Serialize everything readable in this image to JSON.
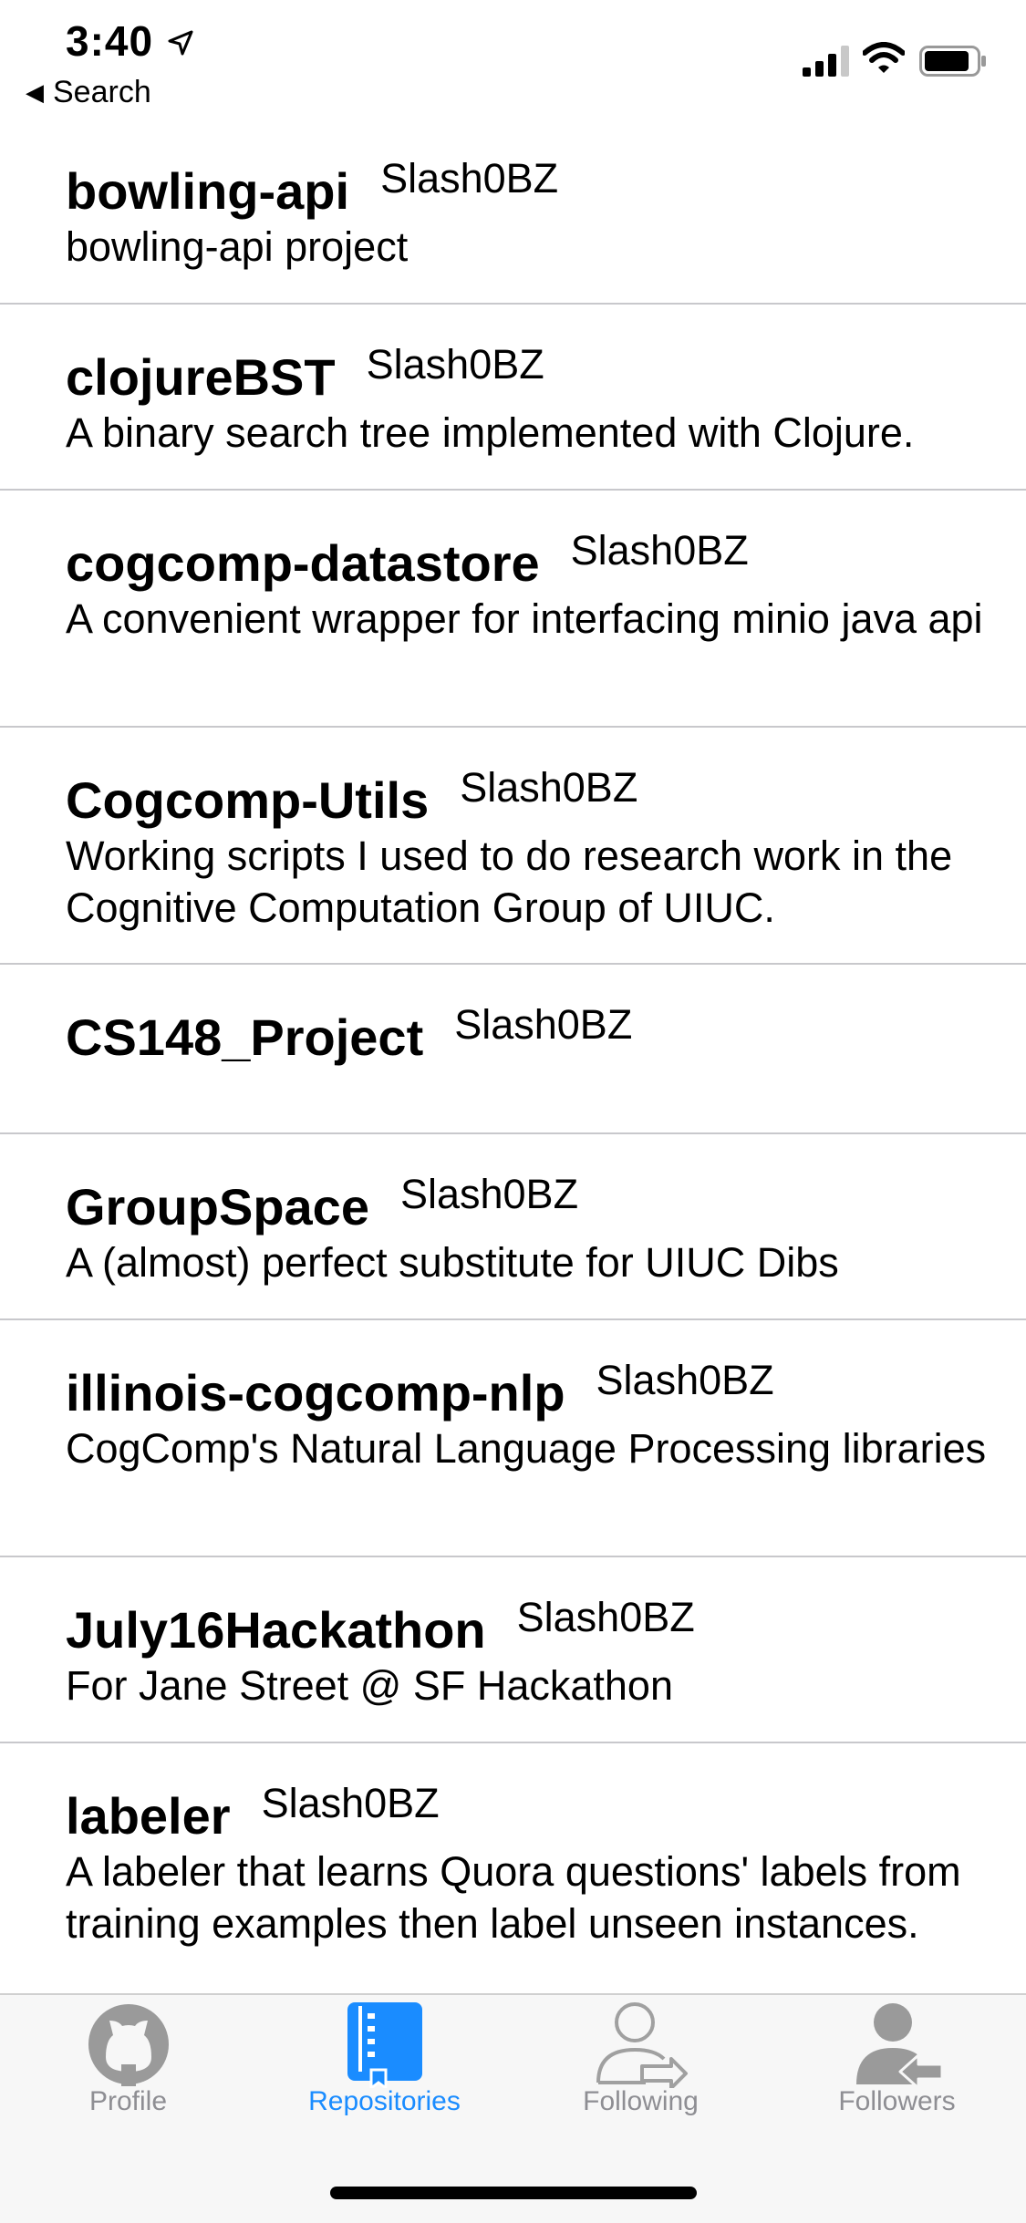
{
  "status_bar": {
    "time": "3:40",
    "back_label": "Search"
  },
  "repositories": [
    {
      "name": "bowling-api",
      "owner": "Slash0BZ",
      "description": "bowling-api project"
    },
    {
      "name": "clojureBST",
      "owner": "Slash0BZ",
      "description": "A binary search tree implemented with Clojure."
    },
    {
      "name": "cogcomp-datastore",
      "owner": "Slash0BZ",
      "description": "A convenient wrapper for interfacing minio java api"
    },
    {
      "name": "Cogcomp-Utils",
      "owner": "Slash0BZ",
      "description": "Working scripts I used to do research work in the Cognitive Computation Group of UIUC."
    },
    {
      "name": "CS148_Project",
      "owner": "Slash0BZ",
      "description": ""
    },
    {
      "name": "GroupSpace",
      "owner": "Slash0BZ",
      "description": "A (almost) perfect substitute for UIUC Dibs"
    },
    {
      "name": "illinois-cogcomp-nlp",
      "owner": "Slash0BZ",
      "description": "CogComp's Natural Language Processing libraries"
    },
    {
      "name": "July16Hackathon",
      "owner": "Slash0BZ",
      "description": "For Jane Street @ SF Hackathon"
    },
    {
      "name": "labeler",
      "owner": "Slash0BZ",
      "description": "A labeler that learns Quora questions' labels from training examples then label unseen instances."
    }
  ],
  "tab_bar": {
    "tabs": [
      {
        "label": "Profile",
        "icon": "github-icon",
        "active": false
      },
      {
        "label": "Repositories",
        "icon": "repo-book-icon",
        "active": true
      },
      {
        "label": "Following",
        "icon": "person-arrow-right-icon",
        "active": false
      },
      {
        "label": "Followers",
        "icon": "person-arrow-left-icon",
        "active": false
      }
    ]
  },
  "colors": {
    "accent": "#1a8cff",
    "inactive": "#8e8e93",
    "separator": "#c8c8cc"
  }
}
